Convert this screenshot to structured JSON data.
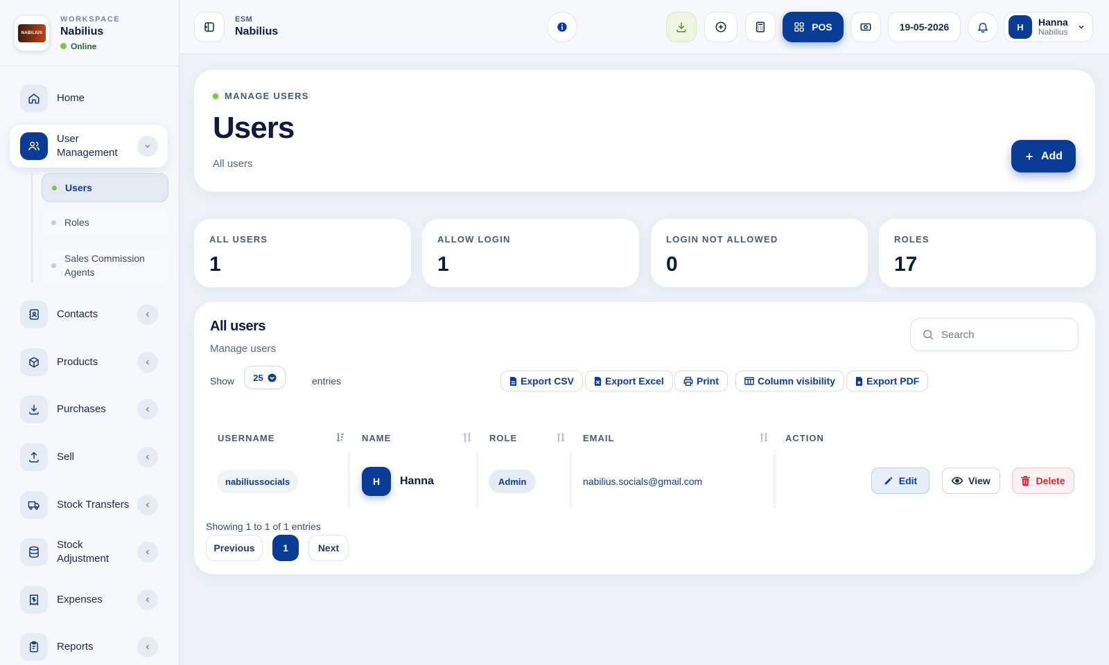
{
  "workspace": {
    "kicker": "WORKSPACE",
    "name": "Nabilius",
    "status": "Online",
    "logo_text": "NABILIUS"
  },
  "sidebar": {
    "items": [
      {
        "label": "Home",
        "icon": "home-icon"
      },
      {
        "label": "User Management",
        "icon": "users-icon",
        "expanded": true
      },
      {
        "label": "Contacts",
        "icon": "contacts-icon"
      },
      {
        "label": "Products",
        "icon": "box-icon"
      },
      {
        "label": "Purchases",
        "icon": "download-icon"
      },
      {
        "label": "Sell",
        "icon": "upload-icon"
      },
      {
        "label": "Stock Transfers",
        "icon": "truck-icon"
      },
      {
        "label": "Stock Adjustment",
        "icon": "database-icon"
      },
      {
        "label": "Expenses",
        "icon": "receipt-icon"
      },
      {
        "label": "Reports",
        "icon": "clipboard-icon"
      }
    ],
    "subitems": [
      {
        "label": "Users",
        "active": true
      },
      {
        "label": "Roles",
        "active": false
      },
      {
        "label": "Sales Commission Agents",
        "active": false
      }
    ]
  },
  "topbar": {
    "kicker": "ESM",
    "title": "Nabilius",
    "pos_label": "POS",
    "date": "19-05-2026",
    "user": {
      "initial": "H",
      "name": "Hanna",
      "sub": "Nabilius"
    }
  },
  "header": {
    "kicker": "MANAGE USERS",
    "title": "Users",
    "subtitle": "All users",
    "add_label": "Add"
  },
  "stats": [
    {
      "label": "ALL USERS",
      "value": "1"
    },
    {
      "label": "ALLOW LOGIN",
      "value": "1"
    },
    {
      "label": "LOGIN NOT ALLOWED",
      "value": "0"
    },
    {
      "label": "ROLES",
      "value": "17"
    }
  ],
  "table_card": {
    "title": "All users",
    "subtitle": "Manage users",
    "search_placeholder": "Search",
    "show_label": "Show",
    "entries_value": "25",
    "entries_label": "entries",
    "buttons": [
      "Export CSV",
      "Export Excel",
      "Print",
      "Column visibility",
      "Export PDF"
    ],
    "columns": [
      "USERNAME",
      "NAME",
      "ROLE",
      "EMAIL",
      "ACTION"
    ],
    "rows": [
      {
        "username": "nabiliussocials",
        "initial": "H",
        "name": "Hanna",
        "role": "Admin",
        "email": "nabilius.socials@gmail.com"
      }
    ],
    "actions": {
      "edit": "Edit",
      "view": "View",
      "delete": "Delete"
    },
    "info": "Showing 1 to 1 of 1 entries",
    "pagination": {
      "previous": "Previous",
      "current": "1",
      "next": "Next"
    }
  },
  "colors": {
    "primary": "#0b3c95",
    "online": "#7ac943",
    "danger": "#d6283c"
  }
}
